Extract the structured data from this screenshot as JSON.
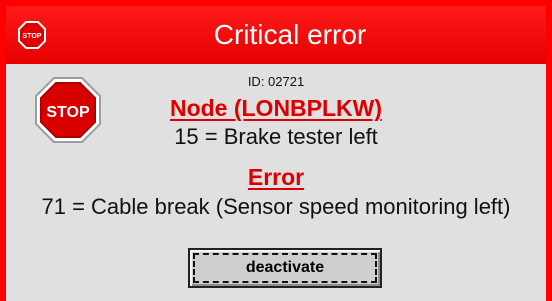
{
  "window": {
    "title": "Critical error",
    "title_icon": "stop-sign-icon",
    "title_icon_text": "STOP"
  },
  "message": {
    "id": "ID: 02721",
    "stop_icon": "stop-sign-icon",
    "stop_text": "STOP",
    "node_heading": "Node (LONBPLKW)",
    "node_value": "15 = Brake tester left",
    "error_heading": "Error",
    "error_value": "71 = Cable break (Sensor speed monitoring left)"
  },
  "actions": {
    "deactivate_label": "deactivate"
  },
  "colors": {
    "frame": "#ff0000",
    "title_background": "#ee0000",
    "content_background": "#e0e0e0",
    "heading_text": "#dd0000",
    "button_background": "#cfcfcf"
  }
}
